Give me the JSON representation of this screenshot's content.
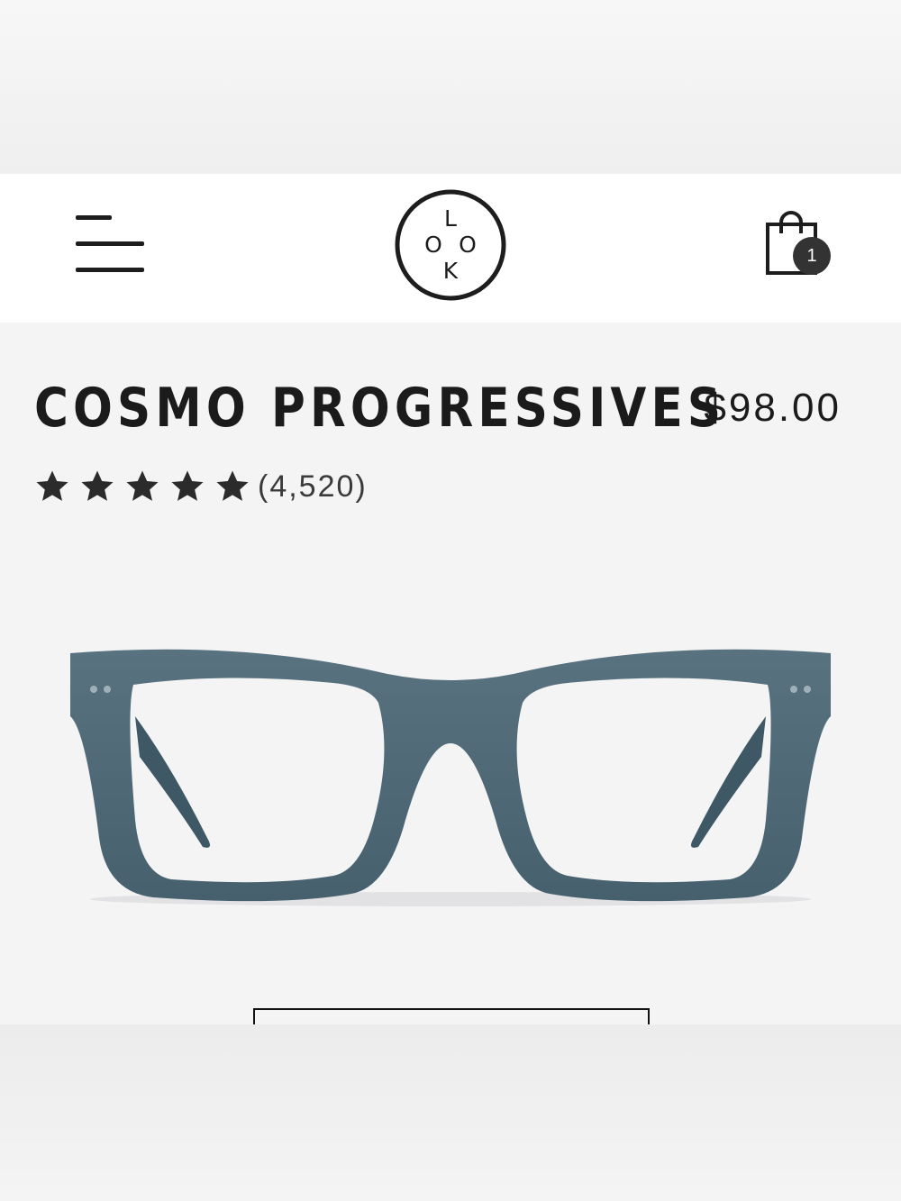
{
  "header": {
    "logo_letters": {
      "top": "L",
      "left": "O",
      "right": "O",
      "bottom": "K"
    },
    "cart_count": "1"
  },
  "product": {
    "title": "COSMO PROGRESSIVES",
    "price": "$98.00",
    "rating": 5,
    "review_count": "(4,520)",
    "frame_color": "#4d6674"
  },
  "icons": {
    "menu": "hamburger-menu-icon",
    "cart": "shopping-bag-icon",
    "star": "star-icon"
  },
  "colors": {
    "text": "#1b1b1b",
    "background": "#f4f4f5",
    "badge": "#333333"
  }
}
